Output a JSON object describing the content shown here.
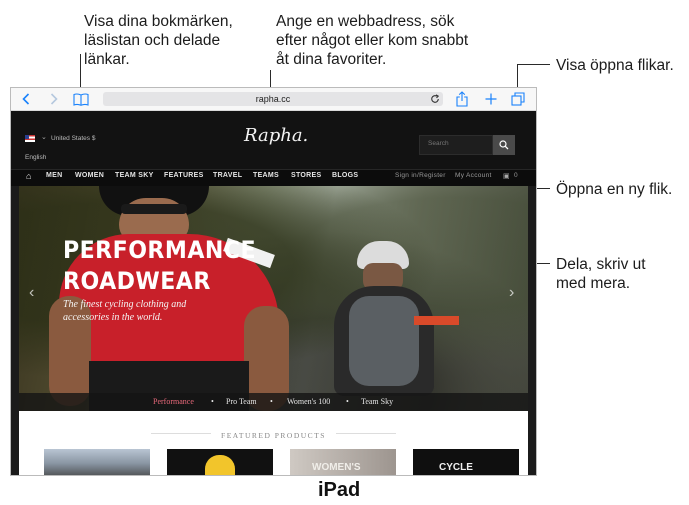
{
  "callouts": {
    "bookmarks": [
      "Visa dina bokmärken,",
      "läslistan och delade",
      "länkar."
    ],
    "address": [
      "Ange en webbadress, sök",
      "efter något eller kom snabbt",
      "åt dina favoriter."
    ],
    "tabs": "Visa öppna flikar.",
    "new_tab": "Öppna en ny flik.",
    "share": [
      "Dela, skriv ut",
      "med mera."
    ]
  },
  "safari": {
    "url": "rapha.cc",
    "accent_color": "#1a82fb"
  },
  "site": {
    "region": "United States $",
    "language": "English",
    "logo": "Rapha.",
    "search_placeholder": "Search",
    "nav": [
      "MEN",
      "WOMEN",
      "TEAM SKY",
      "FEATURES",
      "TRAVEL",
      "TEAMS",
      "STORES",
      "BLOGS"
    ],
    "sign_in": "Sign in/Register",
    "account": "My Account",
    "cart_count": "0",
    "hero_title": [
      "PERFORMANCE",
      "ROADWEAR"
    ],
    "hero_tagline": [
      "The finest cycling clothing and",
      "accessories in the world."
    ],
    "subnav": [
      "Performance",
      "Pro Team",
      "Women's 100",
      "Team Sky"
    ],
    "featured_title": "FEATURED PRODUCTS",
    "product_texts": [
      "WOMEN'S",
      "CYCLE"
    ]
  },
  "caption": "iPad"
}
